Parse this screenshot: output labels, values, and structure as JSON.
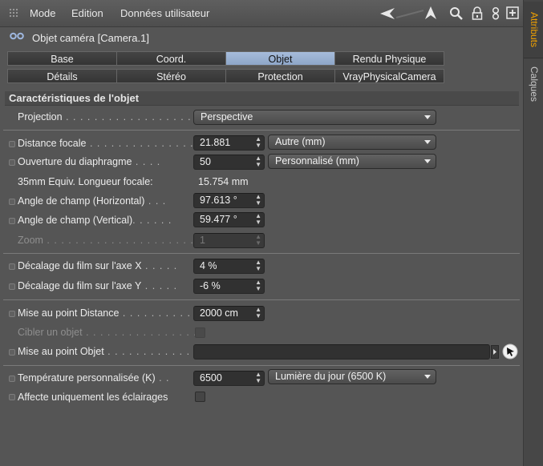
{
  "menubar": {
    "items": [
      "Mode",
      "Edition",
      "Données utilisateur"
    ]
  },
  "sidetabs": {
    "attributes": "Attributs",
    "layers": "Calques"
  },
  "header": {
    "title": "Objet caméra [Camera.1]"
  },
  "tabs": [
    [
      "Base",
      "Coord.",
      "Objet",
      "Rendu Physique"
    ],
    [
      "Détails",
      "Stéréo",
      "Protection",
      "VrayPhysicalCamera"
    ]
  ],
  "active_tab": "Objet",
  "section": {
    "title": "Caractéristiques de l'objet"
  },
  "fields": {
    "projection": {
      "label": "Projection",
      "value": "Perspective"
    },
    "focal_distance": {
      "label": "Distance focale",
      "value": "21.881",
      "preset": "Autre (mm)"
    },
    "aperture": {
      "label": "Ouverture du diaphragme",
      "value": "50",
      "preset": "Personnalisé (mm)"
    },
    "equiv_35mm": {
      "label": "35mm Equiv. Longueur focale:",
      "value": "15.754 mm"
    },
    "fov_h": {
      "label": "Angle de champ (Horizontal)",
      "value": "97.613 °"
    },
    "fov_v": {
      "label": "Angle de champ (Vertical)",
      "value": "59.477 °"
    },
    "zoom": {
      "label": "Zoom",
      "value": "1"
    },
    "film_x": {
      "label": "Décalage du film sur l'axe X",
      "value": "4 %"
    },
    "film_y": {
      "label": "Décalage du film sur l'axe Y",
      "value": "-6 %"
    },
    "focus_distance": {
      "label": "Mise au point Distance",
      "value": "2000 cm"
    },
    "target_object": {
      "label": "Cibler un objet"
    },
    "focus_object": {
      "label": "Mise au point Objet",
      "value": ""
    },
    "color_temp": {
      "label": "Température personnalisée (K)",
      "value": "6500",
      "preset": "Lumière du jour (6500 K)"
    },
    "affect_lights": {
      "label": "Affecte uniquement les éclairages"
    }
  },
  "colors": {
    "accent_tab": "#f0a000",
    "active_tab_bg": "#9db3d4"
  }
}
